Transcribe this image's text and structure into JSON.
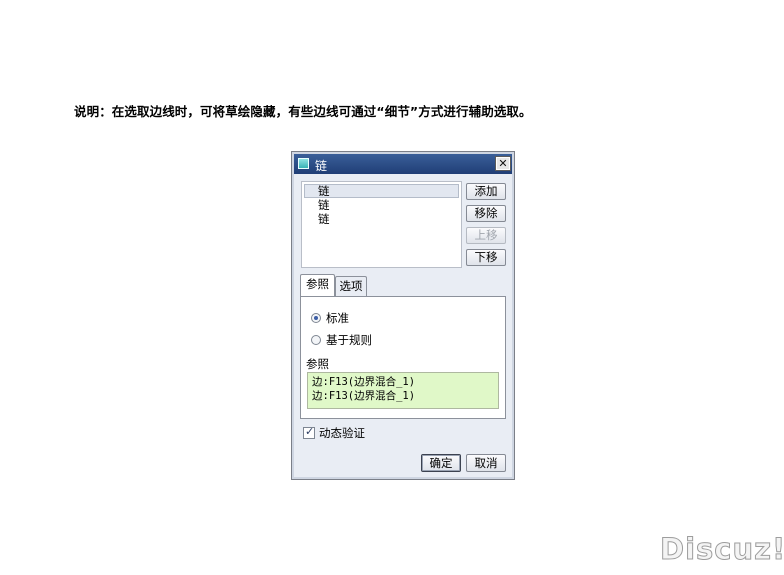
{
  "caption": "说明：在选取边线时，可将草绘隐藏，有些边线可通过“细节”方式进行辅助选取。",
  "dialog": {
    "title": "链",
    "close_symbol": "✕",
    "chains": [
      "链",
      "链",
      "链"
    ],
    "selected_chain_index": 0,
    "buttons": {
      "add": "添加",
      "remove": "移除",
      "move_up": "上移",
      "move_down": "下移"
    },
    "move_up_disabled": true,
    "tabs": [
      "参照",
      "选项"
    ],
    "active_tab": "参照",
    "radio_options": [
      "标准",
      "基于规则"
    ],
    "selected_radio": "标准",
    "reference_label": "参照",
    "references": [
      "边:F13(边界混合_1)",
      "边:F13(边界混合_1)"
    ],
    "dynamic_validation_label": "动态验证",
    "dynamic_validation_checked": true,
    "ok_label": "确定",
    "cancel_label": "取消"
  },
  "watermark": "Discuz!",
  "colors": {
    "titlebar": "#203e76",
    "reference_bg": "#e0f8c8",
    "dialog_bg": "#e9edf4"
  }
}
